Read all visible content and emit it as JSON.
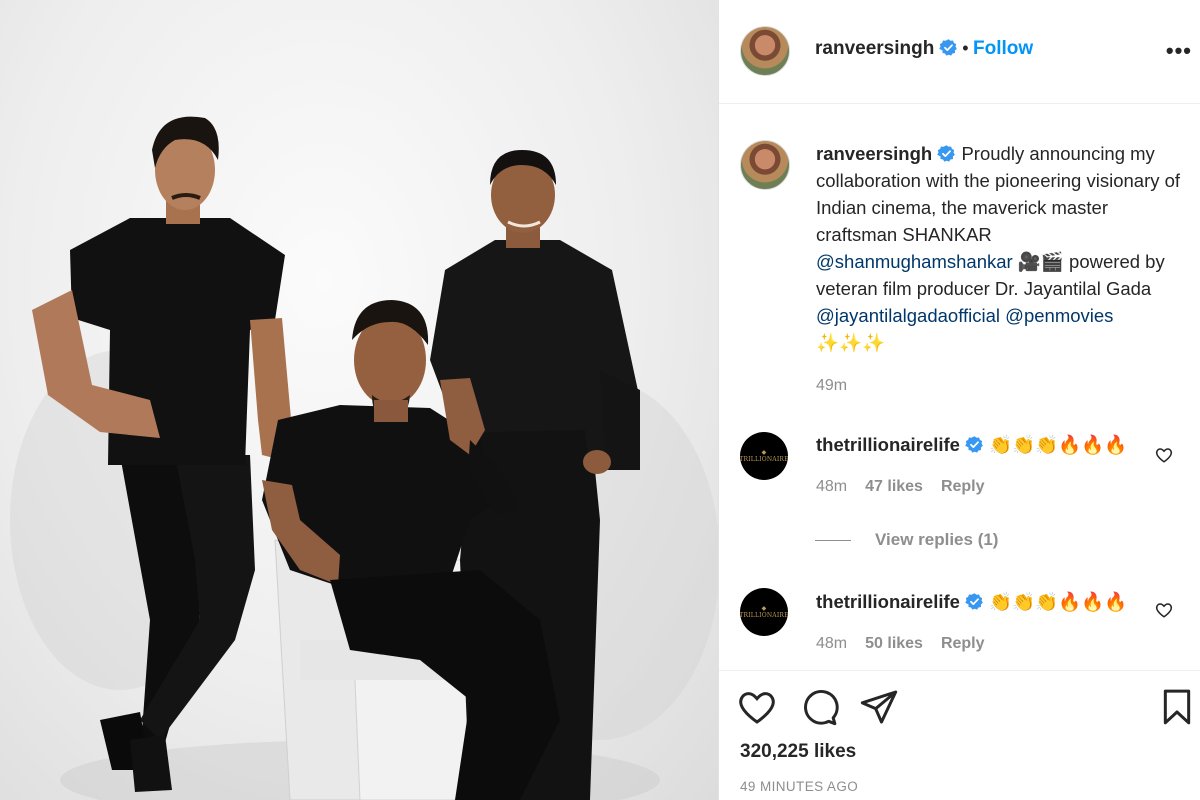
{
  "post": {
    "image_alt": "Three men in black outfits posing against a white studio backdrop",
    "author": {
      "username": "ranveersingh",
      "verified": true,
      "follow_dot": "•",
      "follow_label": "Follow"
    },
    "more_icon": "more-horizontal-icon",
    "caption": {
      "username": "ranveersingh",
      "text_1": " Proudly announcing my collaboration with the pioneering visionary of Indian cinema, the maverick master craftsman SHANKAR ",
      "mention_1": "@shanmughamshankar",
      "text_2": " 🎥🎬 powered by veteran film producer Dr. Jayantilal Gada ",
      "mention_2": "@jayantilalgadaofficial",
      "text_3": " ",
      "mention_3": "@penmovies",
      "text_4": " ✨✨✨",
      "time": "49m"
    },
    "comments": [
      {
        "username": "thetrillionairelife",
        "verified": true,
        "text": "👏👏👏🔥🔥🔥",
        "time": "48m",
        "likes": "47 likes",
        "reply_label": "Reply",
        "avatar_mark": "THE TRILLIONAIRE LIFE"
      },
      {
        "username": "thetrillionairelife",
        "verified": true,
        "text": "👏👏👏🔥🔥🔥",
        "time": "48m",
        "likes": "50 likes",
        "reply_label": "Reply",
        "avatar_mark": "THE TRILLIONAIRE LIFE"
      }
    ],
    "view_replies": "View replies (1)",
    "likes": "320,225 likes",
    "posted_ago": "49 MINUTES AGO"
  },
  "colors": {
    "link_blue": "#0095f6",
    "mention_blue": "#00376b",
    "verified_blue": "#3897f0",
    "text": "#262626",
    "muted": "#8e8e8e"
  }
}
